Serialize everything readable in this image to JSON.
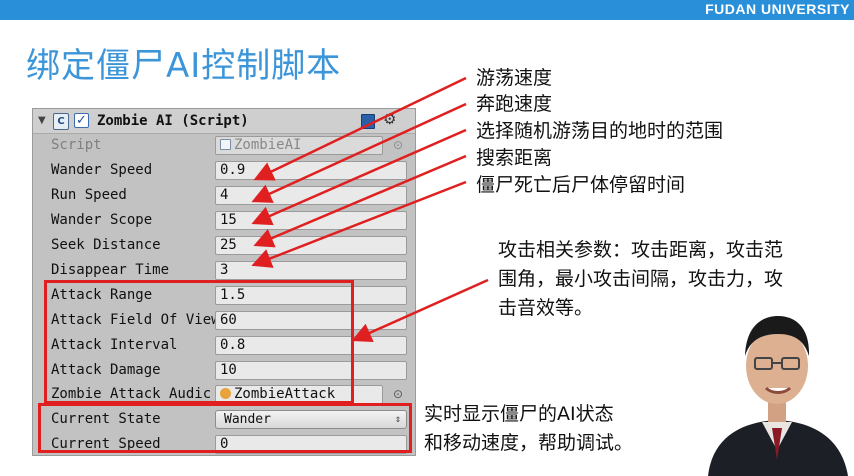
{
  "header": {
    "university": "FUDAN UNIVERSITY"
  },
  "slide": {
    "title": "绑定僵尸AI控制脚本"
  },
  "inspector": {
    "component_title": "Zombie AI (Script)",
    "fields": [
      {
        "label": "Script",
        "value": "ZombieAI",
        "disabled": true
      },
      {
        "label": "Wander Speed",
        "value": "0.9"
      },
      {
        "label": "Run Speed",
        "value": "4"
      },
      {
        "label": "Wander Scope",
        "value": "15"
      },
      {
        "label": "Seek Distance",
        "value": "25"
      },
      {
        "label": "Disappear Time",
        "value": "3"
      },
      {
        "label": "Attack Range",
        "value": "1.5"
      },
      {
        "label": "Attack Field Of View",
        "value": "60"
      },
      {
        "label": "Attack Interval",
        "value": "0.8"
      },
      {
        "label": "Attack Damage",
        "value": "10"
      },
      {
        "label": "Zombie Attack Audic",
        "value": "ZombieAttack"
      },
      {
        "label": "Current State",
        "value": "Wander"
      },
      {
        "label": "Current Speed",
        "value": "0"
      }
    ]
  },
  "annotations": {
    "wander_speed": "游荡速度",
    "run_speed": "奔跑速度",
    "wander_scope": "选择随机游荡目的地时的范围",
    "seek_distance": "搜索距离",
    "disappear_time": "僵尸死亡后尸体停留时间",
    "attack_lines": [
      "攻击相关参数：攻击距离，攻击范",
      "围角，最小攻击间隔，攻击力，攻",
      "击音效等。"
    ],
    "state_lines": [
      "实时显示僵尸的AI状态",
      "和移动速度，帮助调试。"
    ]
  },
  "colors": {
    "accent_blue": "#2a8fd9",
    "title_blue": "#3c95d8",
    "highlight_red": "#e02020"
  }
}
